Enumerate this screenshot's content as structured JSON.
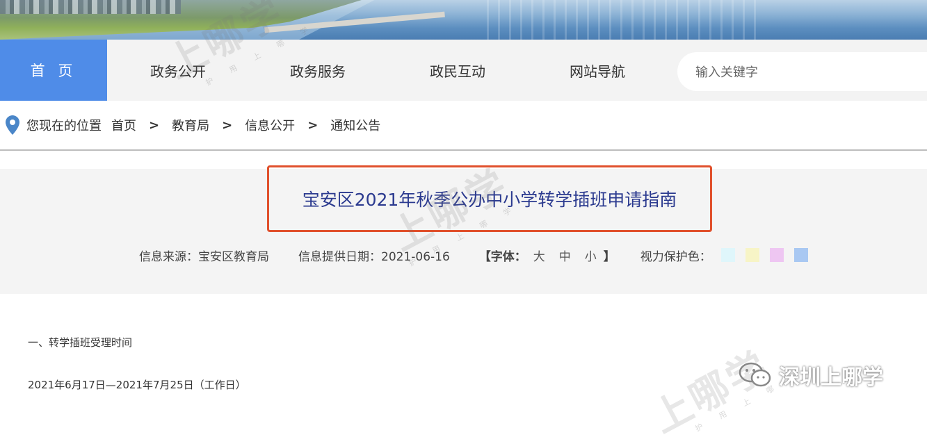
{
  "nav": {
    "home": "首 页",
    "items": [
      "政务公开",
      "政务服务",
      "政民互动",
      "网站导航"
    ],
    "search_placeholder": "输入关键字"
  },
  "breadcrumb": {
    "label": "您现在的位置",
    "items": [
      "首页",
      "教育局",
      "信息公开",
      "通知公告"
    ],
    "separator": ">"
  },
  "article": {
    "title": "宝安区2021年秋季公办中小学转学插班申请指南",
    "source": "信息来源：宝安区教育局",
    "date": "信息提供日期：2021-06-16",
    "font_label": "【字体：",
    "font_options": [
      "大",
      "中",
      "小"
    ],
    "font_close": "】",
    "eye_label": "视力保护色：",
    "eye_colors": [
      "#dff6fb",
      "#f7f4c6",
      "#eec6f2",
      "#a9c8f2"
    ],
    "paragraphs": [
      "一、转学插班受理时间",
      "2021年6月17日—2021年7月25日（工作日）"
    ]
  },
  "watermark": {
    "text": "上哪学",
    "small": "护 用 上 哪 学",
    "brand": "深圳上哪学"
  },
  "colors": {
    "accent": "#4f8ce8",
    "highlight": "#e0502c",
    "title": "#2b3a8f"
  }
}
